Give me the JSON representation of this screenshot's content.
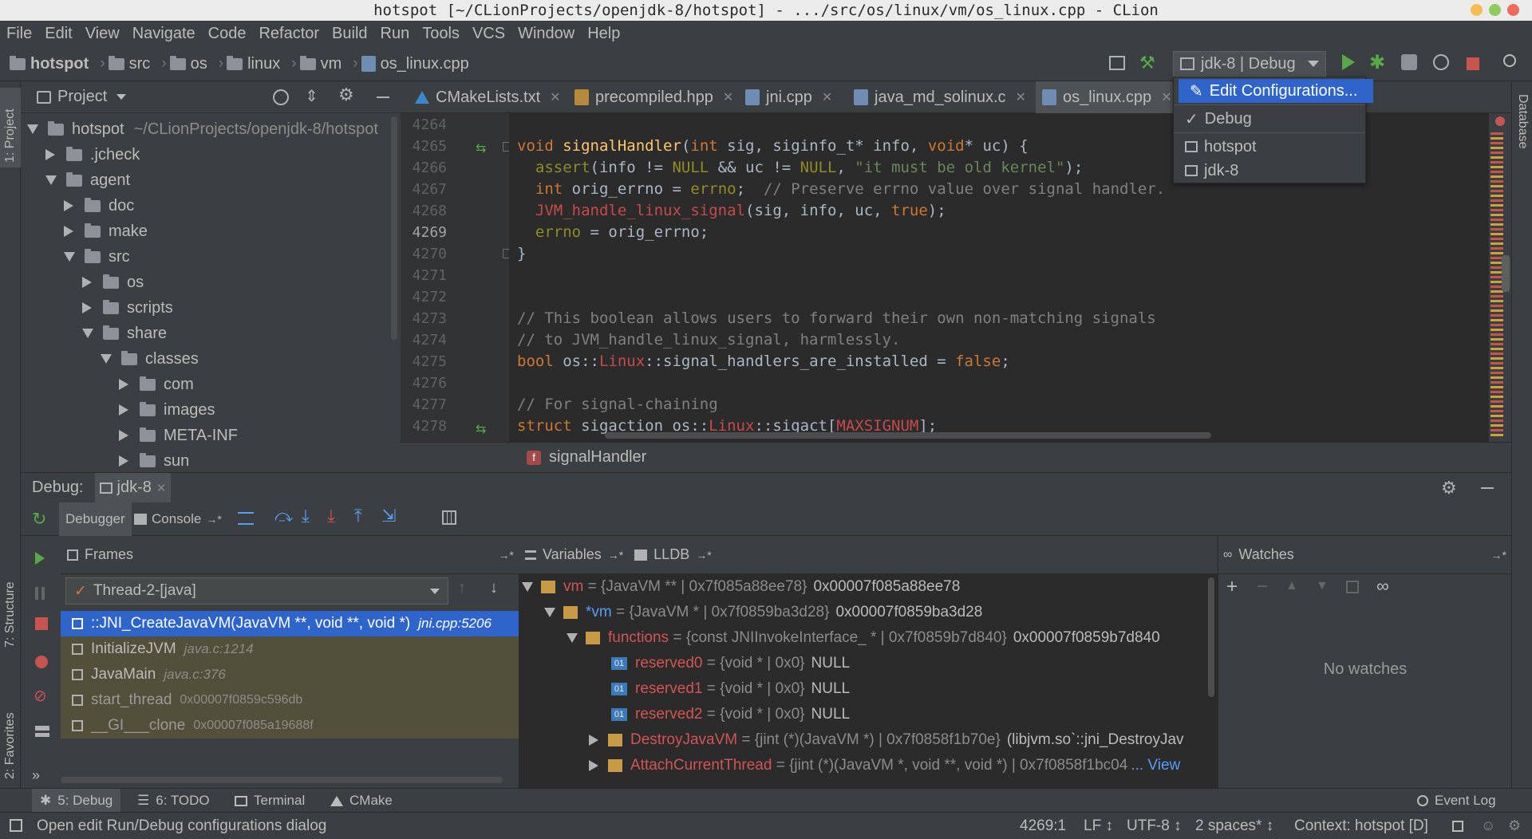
{
  "window": {
    "title": "hotspot [~/CLionProjects/openjdk-8/hotspot] - .../src/os/linux/vm/os_linux.cpp - CLion"
  },
  "menu": [
    "File",
    "Edit",
    "View",
    "Navigate",
    "Code",
    "Refactor",
    "Build",
    "Run",
    "Tools",
    "VCS",
    "Window",
    "Help"
  ],
  "breadcrumbs": [
    "hotspot",
    "src",
    "os",
    "linux",
    "vm",
    "os_linux.cpp"
  ],
  "run_config": {
    "label": "jdk-8 | Debug"
  },
  "config_dropdown": {
    "items": [
      "Edit Configurations...",
      "Debug",
      "hotspot",
      "jdk-8"
    ],
    "checked": "Debug"
  },
  "project_panel": {
    "title": "Project",
    "tree": [
      {
        "label": "hotspot",
        "extra": "~/CLionProjects/openjdk-8/hotspot",
        "depth": 0,
        "state": "open"
      },
      {
        "label": ".jcheck",
        "depth": 1,
        "state": "closed"
      },
      {
        "label": "agent",
        "depth": 1,
        "state": "open"
      },
      {
        "label": "doc",
        "depth": 2,
        "state": "closed"
      },
      {
        "label": "make",
        "depth": 2,
        "state": "closed"
      },
      {
        "label": "src",
        "depth": 2,
        "state": "open"
      },
      {
        "label": "os",
        "depth": 3,
        "state": "closed"
      },
      {
        "label": "scripts",
        "depth": 3,
        "state": "closed"
      },
      {
        "label": "share",
        "depth": 3,
        "state": "open"
      },
      {
        "label": "classes",
        "depth": 4,
        "state": "open"
      },
      {
        "label": "com",
        "depth": 5,
        "state": "closed"
      },
      {
        "label": "images",
        "depth": 5,
        "state": "closed"
      },
      {
        "label": "META-INF",
        "depth": 5,
        "state": "closed"
      },
      {
        "label": "sun",
        "depth": 5,
        "state": "closed"
      }
    ]
  },
  "left_strip": {
    "project": "1: Project",
    "structure": "7: Structure",
    "favorites": "2: Favorites"
  },
  "right_strip": {
    "database": "Database"
  },
  "editor_tabs": [
    "CMakeLists.txt",
    "precompiled.hpp",
    "jni.cpp",
    "java_md_solinux.c",
    "os_linux.cpp"
  ],
  "active_tab": "os_linux.cpp",
  "editor": {
    "line_numbers": [
      "4264",
      "4265",
      "4266",
      "4267",
      "4268",
      "4269",
      "4270",
      "4271",
      "4272",
      "4273",
      "4274",
      "4275",
      "4276",
      "4277",
      "4278"
    ],
    "current_line": "4269",
    "code_breadcrumb": "signalHandler"
  },
  "debug": {
    "title": "Debug:",
    "session": "jdk-8",
    "tabs": {
      "debugger": "Debugger",
      "console": "Console"
    },
    "frames": {
      "title": "Frames",
      "thread": "Thread-2-[java]",
      "rows": [
        {
          "fn": "::JNI_CreateJavaVM(JavaVM **, void **, void *)",
          "loc": "jni.cpp:5206"
        },
        {
          "fn": "InitializeJVM",
          "loc": "java.c:1214"
        },
        {
          "fn": "JavaMain",
          "loc": "java.c:376"
        },
        {
          "fn": "start_thread",
          "loc": "0x00007f0859c596db"
        },
        {
          "fn": "__GI___clone",
          "loc": "0x00007f085a19688f"
        }
      ]
    },
    "variables": {
      "title": "Variables",
      "lldb": "LLDB",
      "rows": [
        {
          "name": "vm",
          "type": "{JavaVM ** | 0x7f085a88ee78}",
          "value": "0x00007f085a88ee78"
        },
        {
          "name": "*vm",
          "type": "{JavaVM * | 0x7f0859ba3d28}",
          "value": "0x00007f0859ba3d28"
        },
        {
          "name": "functions",
          "type": "{const JNIInvokeInterface_ * | 0x7f0859b7d840}",
          "value": "0x00007f0859b7d840"
        },
        {
          "name": "reserved0",
          "type": "{void * | 0x0}",
          "value": "NULL"
        },
        {
          "name": "reserved1",
          "type": "{void * | 0x0}",
          "value": "NULL"
        },
        {
          "name": "reserved2",
          "type": "{void * | 0x0}",
          "value": "NULL"
        },
        {
          "name": "DestroyJavaVM",
          "type": "{jint (*)(JavaVM *) | 0x7f0858f1b70e}",
          "value": "(libjvm.so`::jni_DestroyJav"
        },
        {
          "name": "AttachCurrentThread",
          "type": "{jint (*)(JavaVM *, void **, void *) | 0x7f0858f1bc04",
          "value": "... View"
        }
      ]
    },
    "watches": {
      "title": "Watches",
      "empty": "No watches"
    }
  },
  "bottom_tools": [
    "5: Debug",
    "6: TODO",
    "Terminal",
    "CMake",
    "Event Log"
  ],
  "status": {
    "message": "Open edit Run/Debug configurations dialog",
    "position": "4269:1",
    "line_sep": "LF ↕",
    "encoding": "UTF-8 ↕",
    "indent": "2 spaces* ↕",
    "context": "Context: hotspot [D]"
  }
}
